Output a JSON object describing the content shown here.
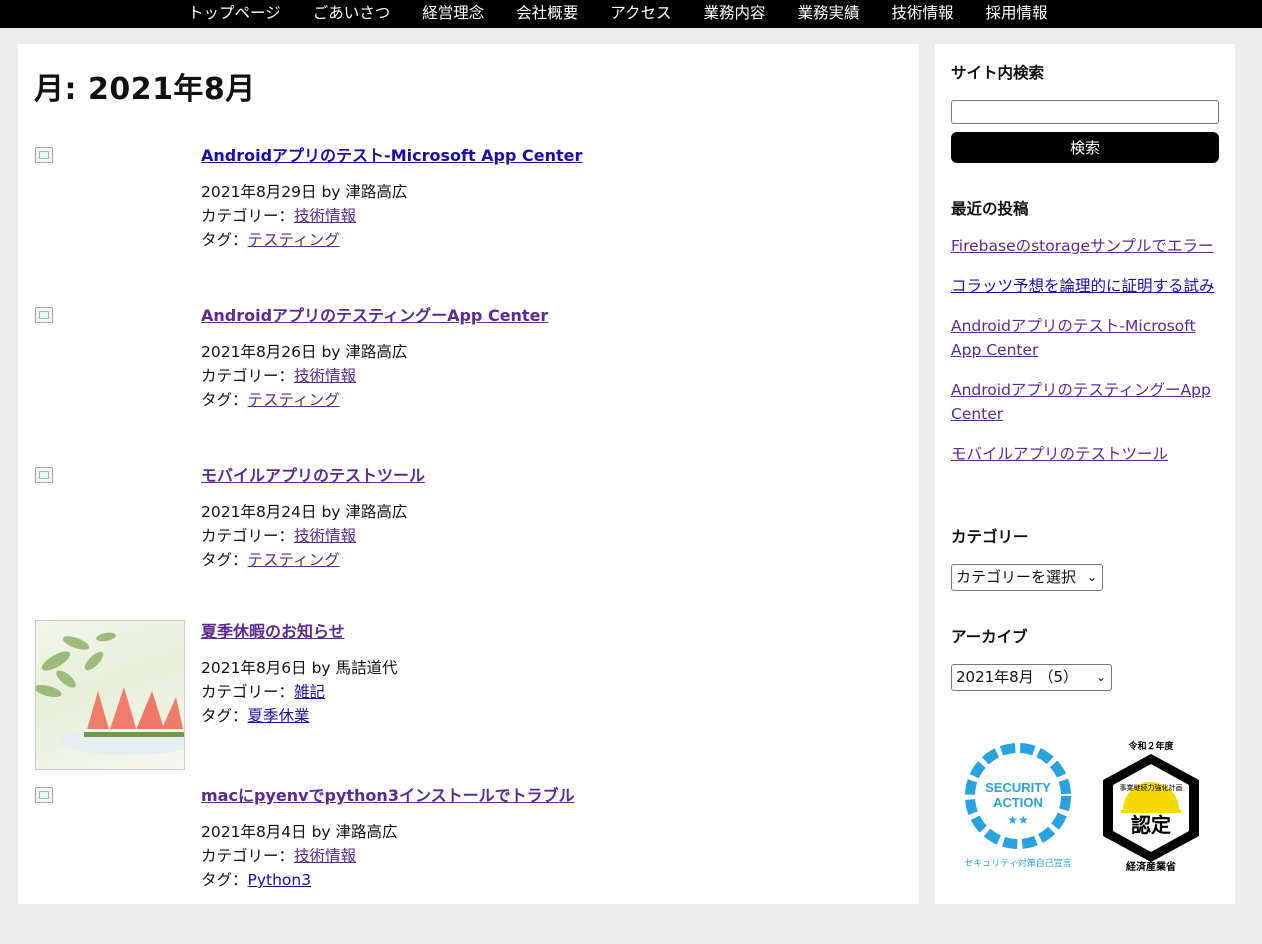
{
  "nav": {
    "items": [
      "トップページ",
      "ごあいさつ",
      "経営理念",
      "会社概要",
      "アクセス",
      "業務内容",
      "業務実績",
      "技術情報",
      "採用情報"
    ]
  },
  "main": {
    "page_title": "月: 2021年8月",
    "posts": [
      {
        "title": "Androidアプリのテスト-Microsoft App Center",
        "date_author": "2021年8月29日 by 津路高広",
        "category_prefix": "カテゴリー：",
        "category": "技術情報",
        "tag_prefix": "タグ：",
        "tag": "テスティング"
      },
      {
        "title": "AndroidアプリのテスティングーApp Center",
        "date_author": "2021年8月26日 by 津路高広",
        "category_prefix": "カテゴリー：",
        "category": "技術情報",
        "tag_prefix": "タグ：",
        "tag": "テスティング"
      },
      {
        "title": "モバイルアプリのテストツール",
        "date_author": "2021年8月24日 by 津路高広",
        "category_prefix": "カテゴリー：",
        "category": "技術情報",
        "tag_prefix": "タグ：",
        "tag": "テスティング"
      },
      {
        "title": "夏季休暇のお知らせ",
        "date_author": "2021年8月6日 by 馬詰道代",
        "category_prefix": "カテゴリー：",
        "category": "雑記",
        "tag_prefix": "タグ：",
        "tag": "夏季休業"
      },
      {
        "title": "macにpyenvでpython3インストールでトラブル",
        "date_author": "2021年8月4日 by 津路高広",
        "category_prefix": "カテゴリー：",
        "category": "技術情報",
        "tag_prefix": "タグ：",
        "tag": "Python3"
      }
    ]
  },
  "sidebar": {
    "search_title": "サイト内検索",
    "search_button": "検索",
    "recent_title": "最近の投稿",
    "recent": [
      "Firebaseのstorageサンプルでエラー",
      "コラッツ予想を論理的に証明する試み",
      "Androidアプリのテスト-Microsoft App Center",
      "AndroidアプリのテスティングーApp Center",
      "モバイルアプリのテストツール"
    ],
    "category_title": "カテゴリー",
    "category_select": "カテゴリーを選択",
    "archive_title": "アーカイブ",
    "archive_select": "2021年8月 （5）",
    "badge_security": {
      "line1": "SECURITY",
      "line2": "ACTION",
      "stars": "★★",
      "caption": "セキュリティ対策自己宣言",
      "color": "#29a3dd"
    },
    "badge_cert": {
      "year": "令和２年度",
      "ring": "事業継続力強化計画",
      "center": "認定",
      "ministry": "経済産業省",
      "color": "#f5d800"
    }
  },
  "colors": {
    "nav_bg": "#000000",
    "link": "#1a0dab",
    "link_visited": "#5b2b8f",
    "page_bg": "#ececec"
  }
}
